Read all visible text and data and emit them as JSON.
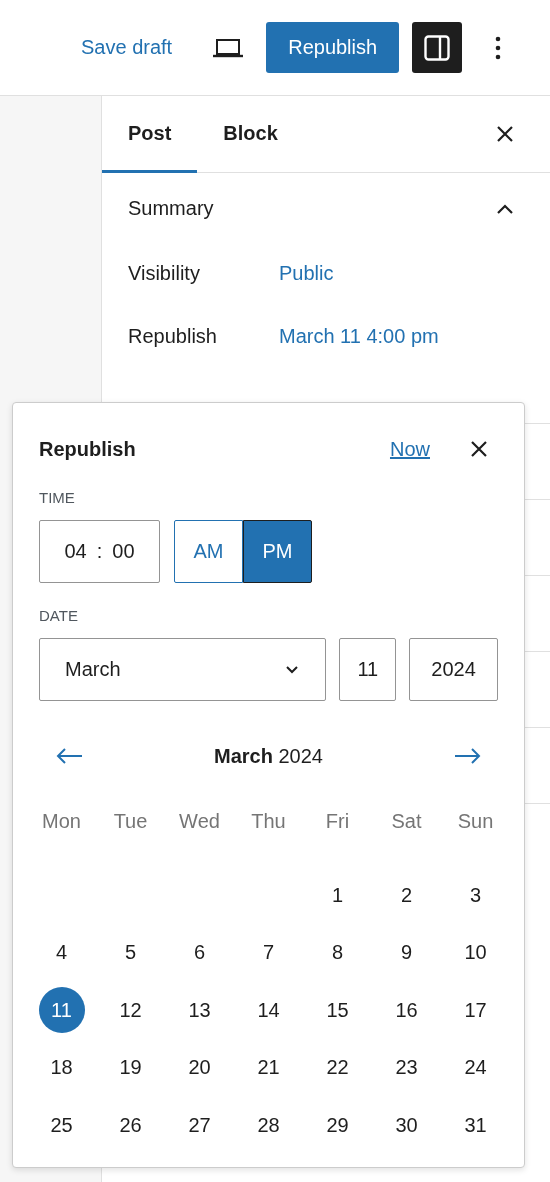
{
  "toolbar": {
    "save_draft": "Save draft",
    "publish_button": "Republish",
    "settings_pressed": true
  },
  "sidebar": {
    "tabs": [
      {
        "label": "Post",
        "selected": true
      },
      {
        "label": "Block",
        "selected": false
      }
    ],
    "summary": {
      "title": "Summary",
      "expanded": true,
      "rows": [
        {
          "label": "Visibility",
          "value": "Public"
        },
        {
          "label": "Republish",
          "value": "March 11 4:00 pm"
        }
      ]
    }
  },
  "popover": {
    "title": "Republish",
    "now_link": "Now",
    "time_label": "TIME",
    "hours": "04",
    "separator": ":",
    "minutes": "00",
    "meridiem": [
      {
        "label": "AM",
        "selected": false
      },
      {
        "label": "PM",
        "selected": true
      }
    ],
    "date_label": "DATE",
    "month": "March",
    "day": "11",
    "year": "2024",
    "calendar_title": "**March** 2024",
    "weekdays": [
      "Mon",
      "Tue",
      "Wed",
      "Thu",
      "Fri",
      "Sat",
      "Sun"
    ],
    "weeks": [
      [
        {
          "day": "1",
          "selected": false
        },
        {
          "day": "2",
          "selected": false
        },
        {
          "day": "3",
          "selected": false
        }
      ],
      [
        {
          "day": "4",
          "selected": false
        },
        {
          "day": "5",
          "selected": false
        },
        {
          "day": "6",
          "selected": false
        },
        {
          "day": "7",
          "selected": false
        },
        {
          "day": "8",
          "selected": false
        },
        {
          "day": "9",
          "selected": false
        },
        {
          "day": "10",
          "selected": false
        }
      ],
      [
        {
          "day": "11",
          "selected": true
        },
        {
          "day": "12",
          "selected": false
        },
        {
          "day": "13",
          "selected": false
        },
        {
          "day": "14",
          "selected": false
        },
        {
          "day": "15",
          "selected": false
        },
        {
          "day": "16",
          "selected": false
        },
        {
          "day": "17",
          "selected": false
        }
      ],
      [
        {
          "day": "18",
          "selected": false
        },
        {
          "day": "19",
          "selected": false
        },
        {
          "day": "20",
          "selected": false
        },
        {
          "day": "21",
          "selected": false
        },
        {
          "day": "22",
          "selected": false
        },
        {
          "day": "23",
          "selected": false
        },
        {
          "day": "24",
          "selected": false
        }
      ],
      [
        {
          "day": "25",
          "selected": false
        },
        {
          "day": "26",
          "selected": false
        },
        {
          "day": "27",
          "selected": false
        },
        {
          "day": "28",
          "selected": false
        },
        {
          "day": "29",
          "selected": false
        },
        {
          "day": "30",
          "selected": false
        },
        {
          "day": "31",
          "selected": false
        }
      ]
    ]
  }
}
